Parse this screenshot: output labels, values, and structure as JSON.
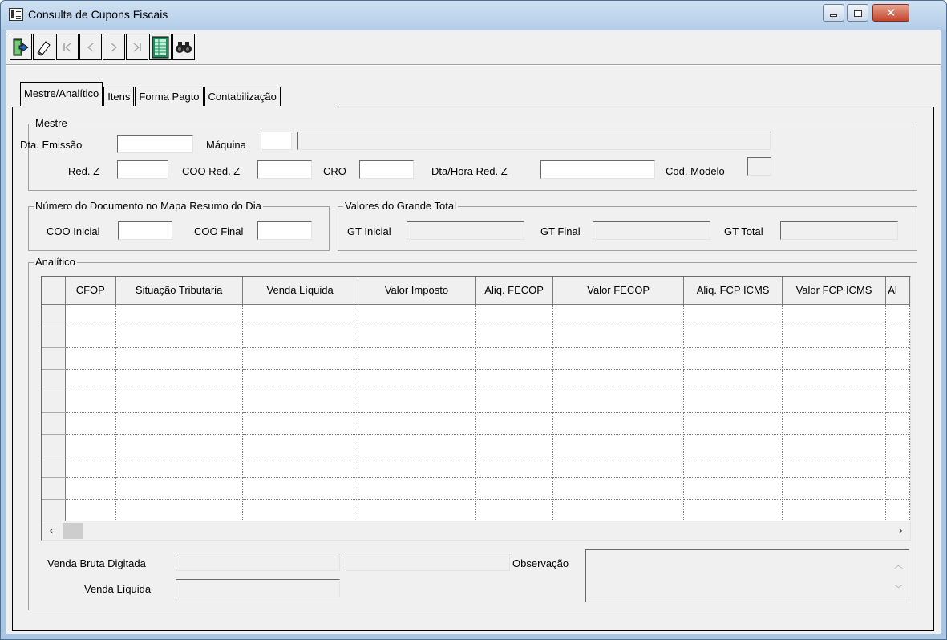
{
  "window": {
    "title": "Consulta de Cupons Fiscais"
  },
  "toolbar": {
    "buttons": [
      {
        "name": "exit",
        "icon": "exit-door-icon",
        "enabled": true
      },
      {
        "name": "clear",
        "icon": "eraser-icon",
        "enabled": true
      },
      {
        "name": "first",
        "icon": "first-record-icon",
        "enabled": false
      },
      {
        "name": "prior",
        "icon": "prior-record-icon",
        "enabled": false
      },
      {
        "name": "next",
        "icon": "next-record-icon",
        "enabled": false
      },
      {
        "name": "last",
        "icon": "last-record-icon",
        "enabled": false
      },
      {
        "name": "report",
        "icon": "spreadsheet-icon",
        "enabled": true
      },
      {
        "name": "search",
        "icon": "binoculars-icon",
        "enabled": true
      }
    ]
  },
  "tabs": [
    "Mestre/Analítico",
    "Itens",
    "Forma Pagto",
    "Contabilização"
  ],
  "mestre": {
    "title": "Mestre",
    "dta_emissao_label": "Dta. Emissão",
    "maquina_label": "Máquina",
    "red_z_label": "Red. Z",
    "coo_red_z_label": "COO Red. Z",
    "cro_label": "CRO",
    "dta_hora_red_z_label": "Dta/Hora Red. Z",
    "cod_modelo_label": "Cod. Modelo"
  },
  "mapa": {
    "title": "Número do Documento no Mapa Resumo do Dia",
    "coo_inicial_label": "COO Inicial",
    "coo_final_label": "COO Final"
  },
  "gt": {
    "title": "Valores do Grande Total",
    "gt_inicial_label": "GT Inicial",
    "gt_final_label": "GT Final",
    "gt_total_label": "GT Total"
  },
  "analitico": {
    "title": "Analítico",
    "columns": [
      "CFOP",
      "Situação Tributaria",
      "Venda Líquida",
      "Valor Imposto",
      "Aliq. FECOP",
      "Valor FECOP",
      "Aliq. FCP ICMS",
      "Valor FCP ICMS",
      "Al"
    ]
  },
  "footer": {
    "venda_bruta_label": "Venda Bruta Digitada",
    "venda_liquida_label": "Venda Líquida",
    "observacao_label": "Observação"
  }
}
